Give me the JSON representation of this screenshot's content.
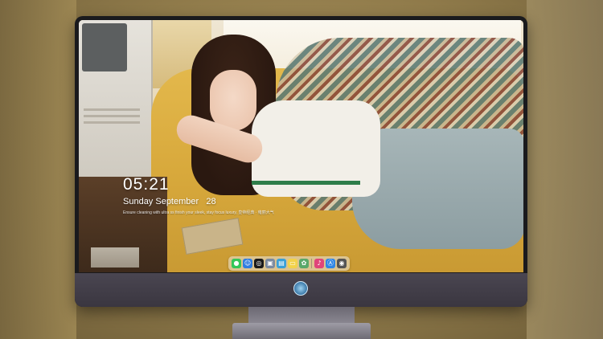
{
  "lockscreen": {
    "time": "05:21",
    "date": "Sunday September   28",
    "note": "Ensure cleaning with ultra ss finish your sleek, stay focus luxury, 皇帝经典 · 雍丽大气"
  },
  "dock": {
    "icons": [
      {
        "name": "messages-icon",
        "glyph": "●",
        "color": "#34c759"
      },
      {
        "name": "finder-icon",
        "glyph": "☺",
        "color": "#2f7de1"
      },
      {
        "name": "safari-icon",
        "glyph": "◎",
        "color": "#1a1a1a"
      },
      {
        "name": "preview-icon",
        "glyph": "▣",
        "color": "#7b8aa0"
      },
      {
        "name": "claquette-icon",
        "glyph": "▤",
        "color": "#3aa0d8"
      },
      {
        "name": "notes-icon",
        "glyph": "▭",
        "color": "#f2d24a"
      },
      {
        "name": "photos-icon",
        "glyph": "✿",
        "color": "#5aa86a"
      },
      {
        "name": "music-icon",
        "glyph": "♪",
        "color": "#e0457a"
      },
      {
        "name": "app-store-icon",
        "glyph": "Ⓐ",
        "color": "#2f86e6"
      },
      {
        "name": "camera-icon",
        "glyph": "◉",
        "color": "#555"
      }
    ]
  },
  "colors": {
    "bezel": "#1a1a1d",
    "chin": "#3a3640",
    "text": "#ffffff"
  }
}
